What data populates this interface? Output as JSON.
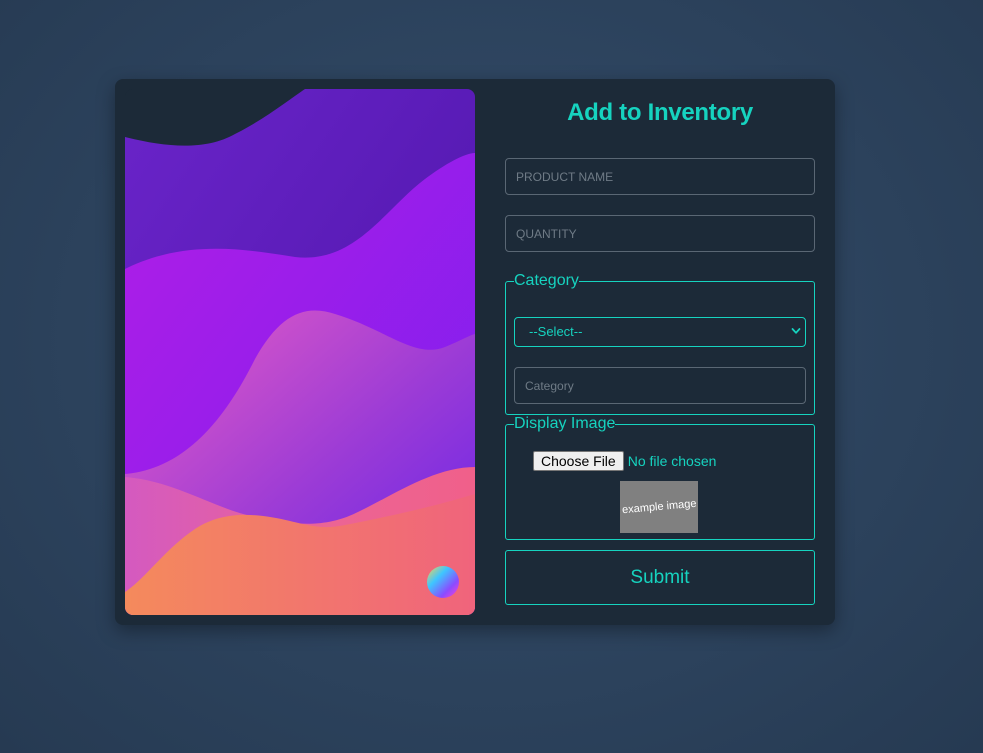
{
  "form": {
    "title": "Add to Inventory",
    "product_name_placeholder": "PRODUCT NAME",
    "quantity_placeholder": "QUANTITY",
    "category_legend": "Category",
    "category_select_value": "--Select--",
    "category_input_placeholder": "Category",
    "image_legend": "Display Image",
    "choose_file_label": "Choose File",
    "file_status": "No file chosen",
    "example_image_text": "example image",
    "submit_label": "Submit"
  },
  "colors": {
    "accent": "#16d3bf",
    "card_bg": "#1c2a38",
    "page_bg": "#2e4560"
  }
}
